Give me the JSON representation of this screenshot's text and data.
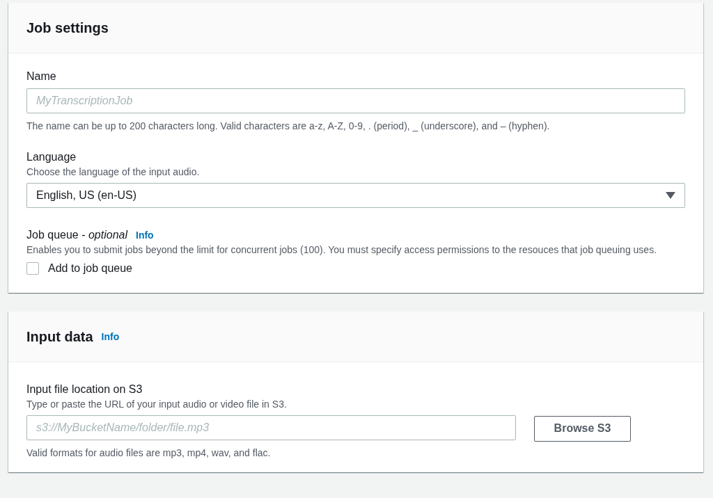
{
  "job_settings": {
    "title": "Job settings",
    "name_field": {
      "label": "Name",
      "placeholder": "MyTranscriptionJob",
      "description": "The name can be up to 200 characters long. Valid characters are a-z, A-Z, 0-9, . (period), _ (underscore), and – (hyphen)."
    },
    "language": {
      "label": "Language",
      "description": "Choose the language of the input audio.",
      "value": "English, US (en-US)"
    },
    "job_queue": {
      "label": "Job queue - *optional*",
      "info": "Info",
      "description": "Enables you to submit jobs beyond the limit for concurrent jobs (100). You must specify access permissions to the resouces that job queuing uses.",
      "checkbox_label": "Add to job queue",
      "checked": false
    }
  },
  "input_data": {
    "title": "Input data",
    "info": "Info",
    "location": {
      "label": "Input file location on S3",
      "description": "Type or paste the URL of your input audio or video file in S3.",
      "placeholder": "s3://MyBucketName/folder/file.mp3",
      "button": "Browse S3",
      "note": "Valid formats for audio files are mp3, mp4, wav, and flac."
    }
  }
}
